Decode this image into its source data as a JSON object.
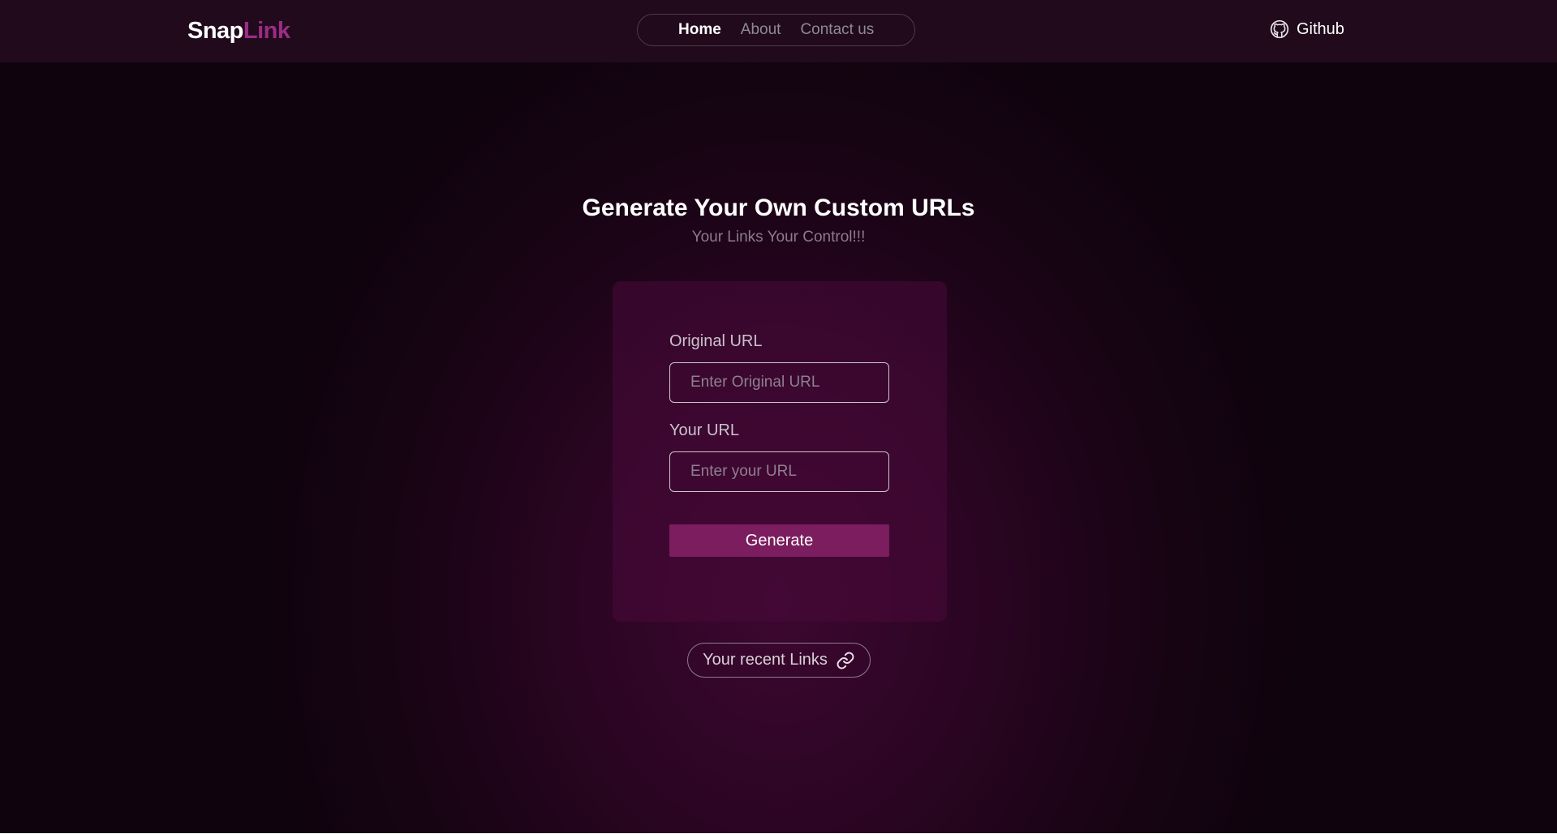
{
  "header": {
    "logo": {
      "part1": "Snap",
      "part2": "Link"
    },
    "nav": [
      {
        "label": "Home",
        "active": true
      },
      {
        "label": "About",
        "active": false
      },
      {
        "label": "Contact us",
        "active": false
      }
    ],
    "github_label": "Github",
    "github_icon": "github-icon"
  },
  "hero": {
    "title": "Generate Your Own Custom URLs",
    "subtitle": "Your Links Your Control!!!"
  },
  "form": {
    "original_url_label": "Original URL",
    "original_url_placeholder": "Enter Original URL",
    "original_url_value": "",
    "your_url_label": "Your URL",
    "your_url_placeholder": "Enter your URL",
    "your_url_value": "",
    "generate_label": "Generate"
  },
  "recent": {
    "label": "Your recent Links",
    "icon": "link-icon"
  },
  "colors": {
    "accent": "#7b1d5e",
    "logo_accent": "#9b2d86",
    "header_bg": "#200a1c",
    "page_bg": "#180414"
  }
}
